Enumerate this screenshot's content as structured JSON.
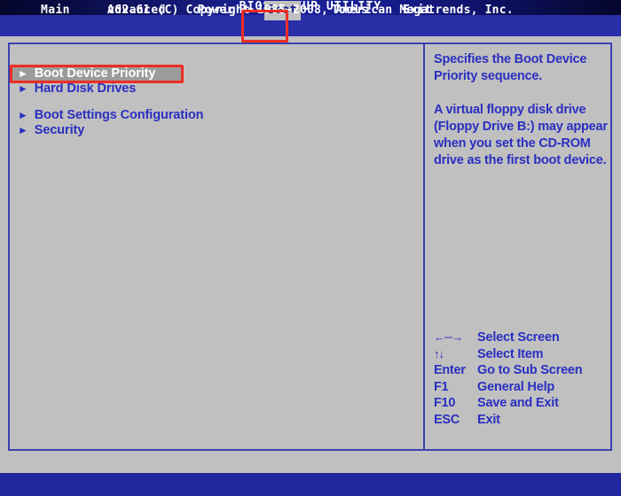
{
  "window": {
    "title": "BIOS SETUP UTILITY"
  },
  "menubar": {
    "tabs": [
      {
        "label": "Main",
        "active": false
      },
      {
        "label": "Advanced",
        "active": false
      },
      {
        "label": "Power",
        "active": false
      },
      {
        "label": "Boot",
        "active": true
      },
      {
        "label": "Tools",
        "active": false
      },
      {
        "label": "Exit",
        "active": false
      }
    ]
  },
  "main": {
    "items": [
      {
        "caret": "caret-right-icon",
        "label": "Boot Device Priority",
        "selected": true
      },
      {
        "caret": "caret-right-icon",
        "label": "Hard Disk Drives",
        "selected": false
      },
      {
        "caret": "caret-right-icon",
        "label": "Boot Settings Configuration",
        "selected": false
      },
      {
        "caret": "caret-right-icon",
        "label": "Security",
        "selected": false
      }
    ]
  },
  "help": {
    "paragraphs": [
      "Specifies the Boot Device Priority sequence.",
      "A virtual floppy disk drive (Floppy Drive B:) may appear when you set the CD-ROM drive as the first boot device."
    ]
  },
  "legend": {
    "rows": [
      {
        "key": "←─→",
        "desc": "Select Screen",
        "symbol": true
      },
      {
        "key": "↑↓",
        "desc": "Select Item",
        "symbol": true
      },
      {
        "key": "Enter",
        "desc": "Go to Sub Screen",
        "symbol": false
      },
      {
        "key": "F1",
        "desc": "General Help",
        "symbol": false
      },
      {
        "key": "F10",
        "desc": "Save and Exit",
        "symbol": false
      },
      {
        "key": "ESC",
        "desc": "Exit",
        "symbol": false
      }
    ]
  },
  "footer": {
    "text": "v02.61 (C) Copyright 1985-2008, American Megatrends, Inc."
  },
  "colors": {
    "background": "#c0c0c0",
    "accent_blue": "#2a2fc0",
    "menubar_blue": "#2a2fa8",
    "footer_blue": "#1f269e",
    "border_blue": "#3b41b0",
    "selection_gray": "#9b9b9b",
    "annotation_red": "#ee2d24"
  }
}
